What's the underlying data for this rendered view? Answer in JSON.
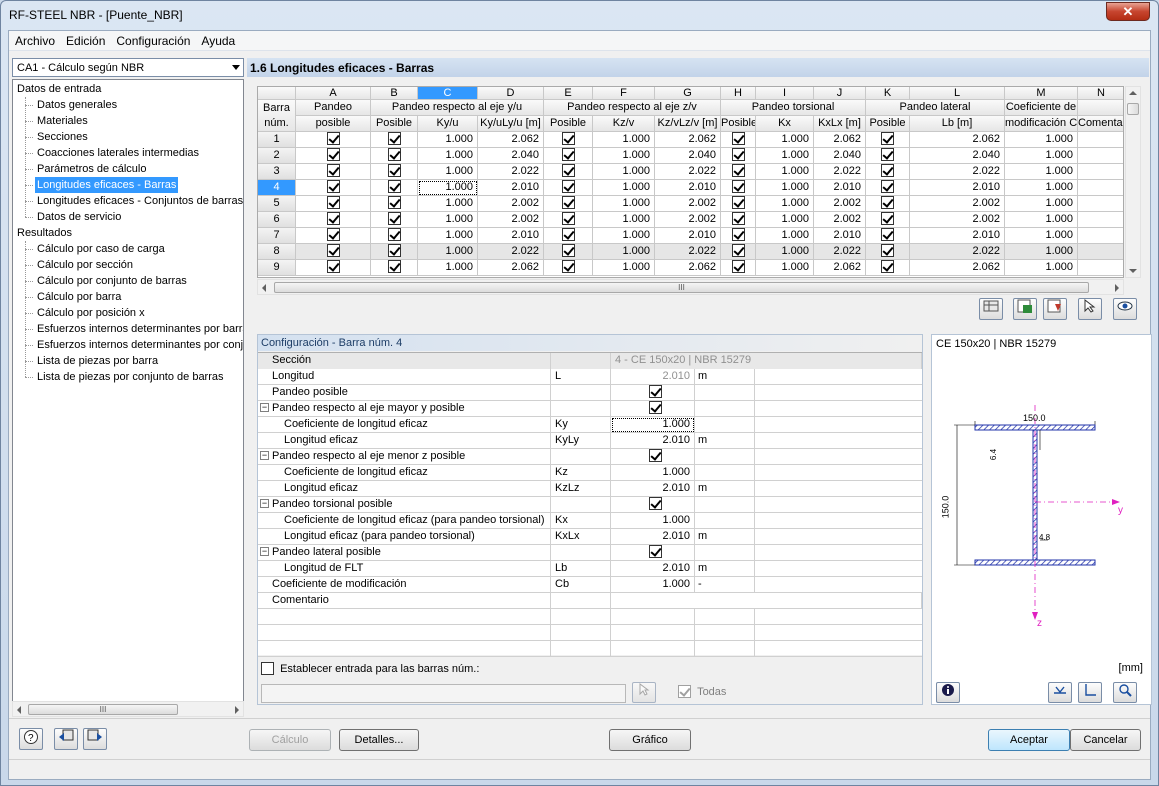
{
  "window": {
    "title": "RF-STEEL NBR - [Puente_NBR]",
    "close": "✕"
  },
  "menu": [
    "Archivo",
    "Edición",
    "Configuración",
    "Ayuda"
  ],
  "case_combo": "CA1 - Cálculo según NBR",
  "section_title": "1.6 Longitudes eficaces - Barras",
  "tree": {
    "input_root": "Datos de entrada",
    "input_items": [
      "Datos generales",
      "Materiales",
      "Secciones",
      "Coacciones laterales intermedias",
      "Parámetros de cálculo",
      "Longitudes eficaces - Barras",
      "Longitudes eficaces - Conjuntos de barras",
      "Datos de servicio"
    ],
    "selected_index": 5,
    "results_root": "Resultados",
    "results_items": [
      "Cálculo por caso de carga",
      "Cálculo por sección",
      "Cálculo por conjunto de barras",
      "Cálculo por barra",
      "Cálculo por posición x",
      "Esfuerzos internos determinantes por barra",
      "Esfuerzos internos determinantes por conjunto",
      "Lista de piezas por barra",
      "Lista de piezas por conjunto de barras"
    ]
  },
  "grid": {
    "letters": [
      "A",
      "B",
      "C",
      "D",
      "E",
      "F",
      "G",
      "H",
      "I",
      "J",
      "K",
      "L",
      "M",
      "N"
    ],
    "rowhead": [
      "Barra",
      "núm."
    ],
    "groups": [
      "Pandeo",
      "Pandeo respecto al eje y/u",
      "Pandeo respecto al eje z/v",
      "Pandeo torsional",
      "Pandeo lateral",
      "Coeficiente de"
    ],
    "subs": [
      "posible",
      "Posible",
      "Ky/u",
      "Ky/uLy/u [m]",
      "Posible",
      "Kz/v",
      "Kz/vLz/v [m]",
      "Posible",
      "Kx",
      "KxLx [m]",
      "Posible",
      "Lb [m]",
      "modificación Cb [-]",
      "Comentario"
    ],
    "rows": [
      [
        "1",
        "1.000",
        "2.062",
        "1.000",
        "2.062",
        "1.000",
        "2.062",
        "2.062",
        "1.000"
      ],
      [
        "2",
        "1.000",
        "2.040",
        "1.000",
        "2.040",
        "1.000",
        "2.040",
        "2.040",
        "1.000"
      ],
      [
        "3",
        "1.000",
        "2.022",
        "1.000",
        "2.022",
        "1.000",
        "2.022",
        "2.022",
        "1.000"
      ],
      [
        "4",
        "1.000",
        "2.010",
        "1.000",
        "2.010",
        "1.000",
        "2.010",
        "2.010",
        "1.000"
      ],
      [
        "5",
        "1.000",
        "2.002",
        "1.000",
        "2.002",
        "1.000",
        "2.002",
        "2.002",
        "1.000"
      ],
      [
        "6",
        "1.000",
        "2.002",
        "1.000",
        "2.002",
        "1.000",
        "2.002",
        "2.002",
        "1.000"
      ],
      [
        "7",
        "1.000",
        "2.010",
        "1.000",
        "2.010",
        "1.000",
        "2.010",
        "2.010",
        "1.000"
      ],
      [
        "8",
        "1.000",
        "2.022",
        "1.000",
        "2.022",
        "1.000",
        "2.022",
        "2.022",
        "1.000"
      ],
      [
        "9",
        "1.000",
        "2.062",
        "1.000",
        "2.062",
        "1.000",
        "2.062",
        "2.062",
        "1.000"
      ]
    ],
    "selected_row": 3,
    "selected_col": "C"
  },
  "config": {
    "title": "Configuración - Barra núm. 4",
    "rows": [
      {
        "label": "Sección",
        "sym": "",
        "val": "4 - CE 150x20 | NBR 15279",
        "unit": "",
        "type": "hdr"
      },
      {
        "label": "Longitud",
        "sym": "L",
        "val": "2.010",
        "unit": "m",
        "type": "gray"
      },
      {
        "label": "Pandeo posible",
        "sym": "",
        "val": "",
        "unit": "",
        "type": "cb"
      },
      {
        "label": "Pandeo respecto al eje mayor y posible",
        "sym": "",
        "val": "",
        "unit": "",
        "type": "grp"
      },
      {
        "label": "Coeficiente de longitud eficaz",
        "sym": "Ky",
        "val": "1.000",
        "unit": "",
        "type": "sub"
      },
      {
        "label": "Longitud eficaz",
        "sym": "KyLy",
        "val": "2.010",
        "unit": "m",
        "type": "sub"
      },
      {
        "label": "Pandeo respecto al eje menor z posible",
        "sym": "",
        "val": "",
        "unit": "",
        "type": "grp"
      },
      {
        "label": "Coeficiente de longitud eficaz",
        "sym": "Kz",
        "val": "1.000",
        "unit": "",
        "type": "sub"
      },
      {
        "label": "Longitud eficaz",
        "sym": "KzLz",
        "val": "2.010",
        "unit": "m",
        "type": "sub"
      },
      {
        "label": "Pandeo torsional posible",
        "sym": "",
        "val": "",
        "unit": "",
        "type": "grp"
      },
      {
        "label": "Coeficiente de longitud eficaz (para pandeo torsional)",
        "sym": "Kx",
        "val": "1.000",
        "unit": "",
        "type": "sub"
      },
      {
        "label": "Longitud eficaz (para pandeo torsional)",
        "sym": "KxLx",
        "val": "2.010",
        "unit": "m",
        "type": "sub"
      },
      {
        "label": "Pandeo lateral posible",
        "sym": "",
        "val": "",
        "unit": "",
        "type": "grp"
      },
      {
        "label": "Longitud de FLT",
        "sym": "Lb",
        "val": "2.010",
        "unit": "m",
        "type": "sub"
      },
      {
        "label": "Coeficiente de modificación",
        "sym": "Cb",
        "val": "1.000",
        "unit": "-",
        "type": "plain"
      },
      {
        "label": "Comentario",
        "sym": "",
        "val": "",
        "unit": "",
        "type": "comment"
      }
    ],
    "set_input_label": "Establecer entrada para las barras núm.:",
    "todas": "Todas"
  },
  "preview": {
    "title": "CE 150x20 | NBR 15279",
    "dim_width": "150.0",
    "dim_height": "150.0",
    "dim_flange": "6.4",
    "dim_web": "4.8",
    "axis_y": "y",
    "axis_z": "z",
    "unit": "[mm]"
  },
  "buttons": {
    "calc": "Cálculo",
    "details": "Detalles...",
    "graphic": "Gráfico",
    "ok": "Aceptar",
    "cancel": "Cancelar"
  }
}
